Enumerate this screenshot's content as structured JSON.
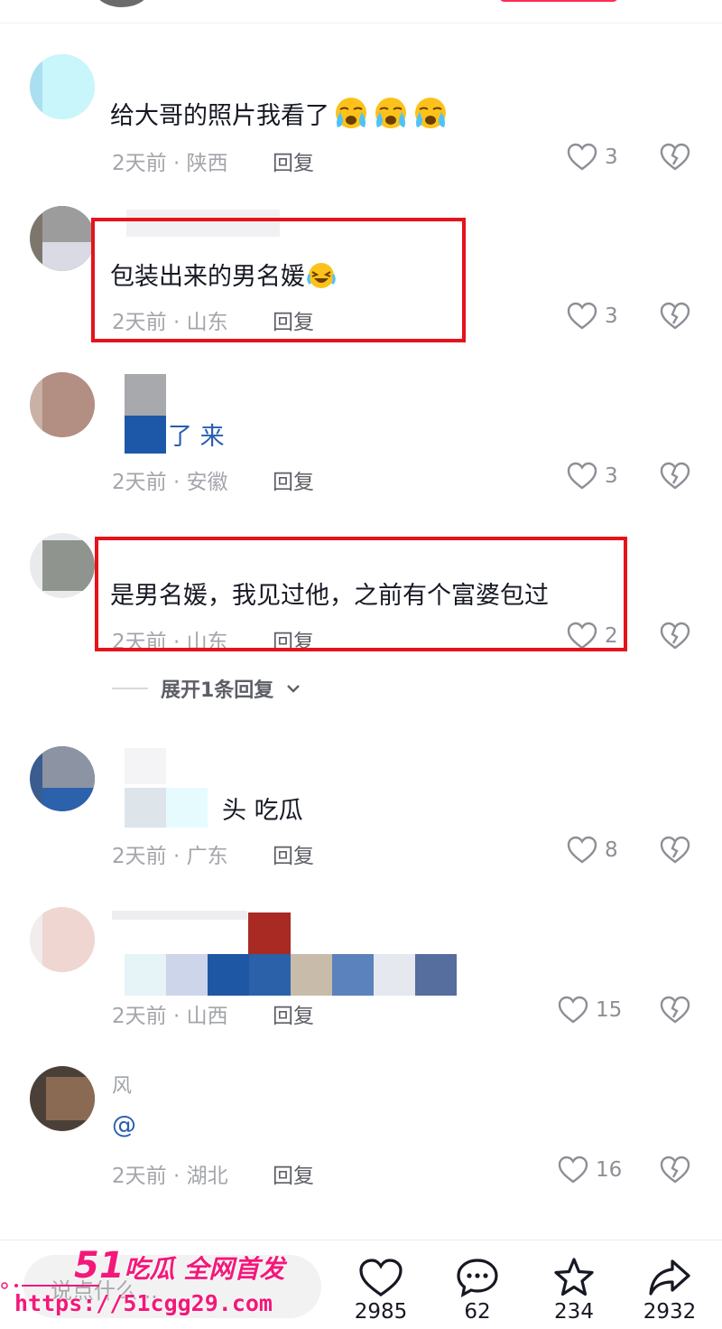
{
  "comments": [
    {
      "text": "给大哥的照片我看了",
      "time": "2天前",
      "location": "陕西",
      "likes": "3",
      "highlighted": false
    },
    {
      "text": "包装出来的男名媛",
      "time": "2天前",
      "location": "山东",
      "likes": "3",
      "highlighted": true
    },
    {
      "text_visible": "了 来",
      "time": "2天前",
      "location": "安徽",
      "likes": "3",
      "highlighted": false
    },
    {
      "text": "是男名媛，我见过他，之前有个富婆包过",
      "time": "2天前",
      "location": "山东",
      "likes": "2",
      "highlighted": true
    },
    {
      "text_visible": "头 吃瓜",
      "time": "2天前",
      "location": "广东",
      "likes": "8",
      "highlighted": false
    },
    {
      "time": "2天前",
      "location": "山西",
      "likes": "15",
      "highlighted": false
    },
    {
      "username_visible": "风",
      "text_visible": "@",
      "time": "2天前",
      "location": "湖北",
      "likes": "16",
      "highlighted": false
    }
  ],
  "meta_separator": " · ",
  "reply_label": "回复",
  "expand_replies": "展开1条回复",
  "input_placeholder": "说点什么...",
  "actions": {
    "likes": "2985",
    "comments": "62",
    "favorites": "234",
    "shares": "2932"
  },
  "watermark": {
    "brand_number": "51",
    "brand_text": "吃瓜 全网首发",
    "url": "https://51cgg29.com"
  },
  "colors": {
    "highlight_box": "#e6131a",
    "watermark": "#f3187a",
    "meta_text": "#a3a5ab"
  }
}
